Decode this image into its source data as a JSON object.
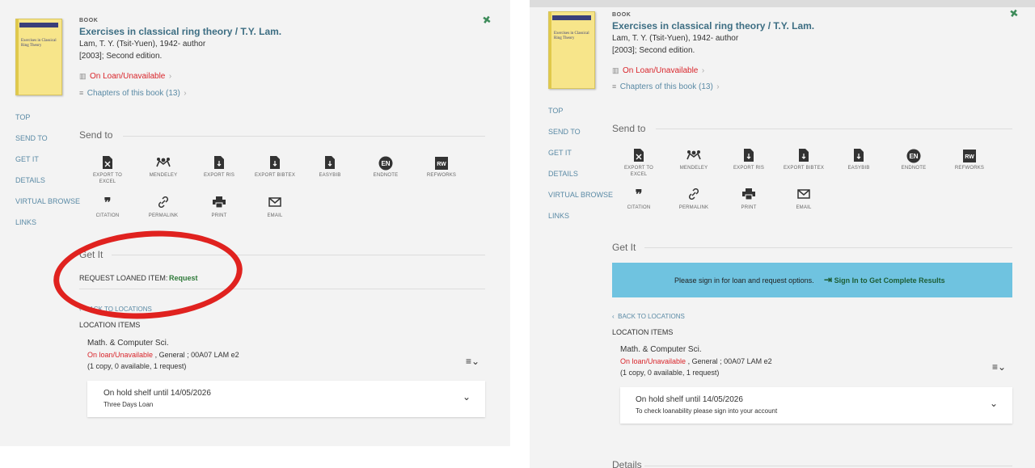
{
  "record": {
    "type": "BOOK",
    "title": "Exercises in classical ring theory / T.Y. Lam.",
    "author": "Lam, T. Y. (Tsit-Yuen), 1942- author",
    "edition": "[2003]; Second edition.",
    "availability": "On Loan/Unavailable",
    "chapters": "Chapters of this book (13)",
    "cover_title": "Exercises in Classical Ring Theory"
  },
  "nav": [
    "TOP",
    "SEND TO",
    "GET IT",
    "DETAILS",
    "VIRTUAL BROWSE",
    "LINKS"
  ],
  "send_to": {
    "title": "Send to",
    "actions": [
      {
        "label": "EXPORT TO",
        "label2": "EXCEL",
        "icon": "excel-icon"
      },
      {
        "label": "MENDELEY",
        "label2": "",
        "icon": "mendeley-icon"
      },
      {
        "label": "EXPORT RIS",
        "label2": "",
        "icon": "file-icon"
      },
      {
        "label": "EXPORT BIBTEX",
        "label2": "",
        "icon": "file-icon"
      },
      {
        "label": "EASYBIB",
        "label2": "",
        "icon": "file-icon"
      },
      {
        "label": "ENDNOTE",
        "label2": "",
        "icon": "endnote-icon"
      },
      {
        "label": "REFWORKS",
        "label2": "",
        "icon": "refworks-icon"
      },
      {
        "label": "CITATION",
        "label2": "",
        "icon": "quote-icon"
      },
      {
        "label": "PERMALINK",
        "label2": "",
        "icon": "link-icon"
      },
      {
        "label": "PRINT",
        "label2": "",
        "icon": "print-icon"
      },
      {
        "label": "EMAIL",
        "label2": "",
        "icon": "email-icon"
      }
    ]
  },
  "get_it": {
    "title": "Get It",
    "request_label": "REQUEST LOANED ITEM:",
    "request_link": "Request",
    "signin_message": "Please sign in for loan and request options.",
    "signin_link": "Sign In to Get Complete Results",
    "back": "BACK TO LOCATIONS",
    "location_items": "LOCATION ITEMS",
    "library": "Math. & Computer Sci.",
    "status": "On loan/Unavailable",
    "shelf": " , General ; 00A07 LAM e2",
    "copies": "(1 copy, 0 available, 1 request)",
    "hold": "On hold shelf until 14/05/2026",
    "loan_type_left": "Three Days Loan",
    "loan_type_right": "To check loanability please sign into your account"
  },
  "details_title": "Details",
  "colors": {
    "accent": "#3d6e83",
    "alert": "#d9252b",
    "signin_bg": "#6fc3e0",
    "annotation": "#e0221f"
  }
}
